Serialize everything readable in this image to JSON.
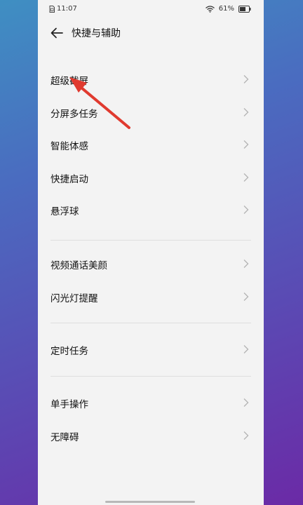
{
  "status_bar": {
    "time": "11:07",
    "battery": "61%",
    "sim_icon": "sim-card-icon",
    "wifi_icon": "wifi-icon",
    "battery_icon": "battery-icon"
  },
  "header": {
    "title": "快捷与辅助",
    "back_icon": "back-arrow-icon"
  },
  "groups": [
    {
      "items": [
        {
          "label": "超级截屏"
        },
        {
          "label": "分屏多任务"
        },
        {
          "label": "智能体感"
        },
        {
          "label": "快捷启动"
        },
        {
          "label": "悬浮球"
        }
      ]
    },
    {
      "items": [
        {
          "label": "视频通话美颜"
        },
        {
          "label": "闪光灯提醒"
        }
      ]
    },
    {
      "items": [
        {
          "label": "定时任务"
        }
      ]
    },
    {
      "items": [
        {
          "label": "单手操作"
        },
        {
          "label": "无障碍"
        }
      ]
    }
  ],
  "annotation": {
    "arrow_color": "#e03a2f",
    "points_to": "超级截屏"
  },
  "colors": {
    "page_background": "#f3f3f3",
    "text": "#111111",
    "chevron": "#b5b5b5",
    "divider": "#dedede"
  }
}
